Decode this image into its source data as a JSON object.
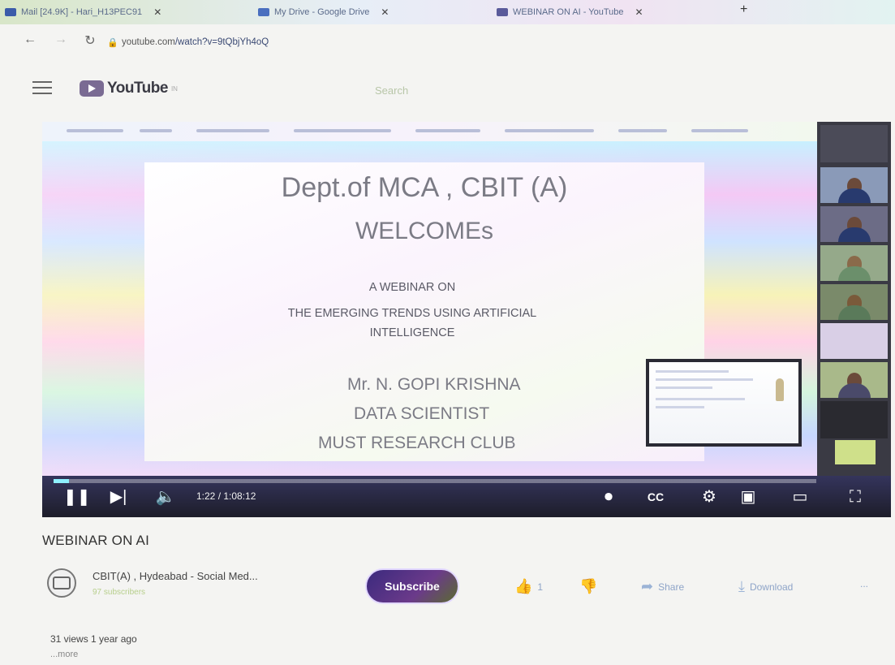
{
  "browser": {
    "tabs": [
      {
        "title": "Mail [24.9K] - Hari_H13PEC91",
        "favicon": "gmail-icon",
        "color": "#3b5ba9"
      },
      {
        "title": "My Drive - Google Drive",
        "favicon": "drive-icon",
        "color": "#4a6fbf"
      },
      {
        "title": "WEBINAR ON AI - YouTube",
        "favicon": "youtube-icon",
        "color": "#5a5a9a"
      }
    ],
    "new_tab_label": "+",
    "url_host": "youtube.com",
    "url_path": "/watch?v=9tQbjYh4oQ"
  },
  "youtube": {
    "logo_text": "YouTube",
    "logo_sup": "IN",
    "search_placeholder": "Search"
  },
  "slide": {
    "line1": "Dept.of MCA , CBIT (A)",
    "line2": "WELCOMEs",
    "subtitle1": "A WEBINAR ON",
    "subtitle2": "THE EMERGING TRENDS USING ARTIFICIAL",
    "subtitle3": "INTELLIGENCE",
    "presenter": "Mr. N. GOPI KRISHNA",
    "role": "DATA SCIENTIST",
    "org": "MUST RESEARCH CLUB"
  },
  "player": {
    "time": "1:22 / 1:08:12",
    "progress_fraction": 0.02
  },
  "video": {
    "title": "WEBINAR ON AI",
    "channel": "CBIT(A) , Hydeabad - Social Med...",
    "subscribers": "97 subscribers",
    "subscribe_label": "Subscribe",
    "likes": "1",
    "share_label": "Share",
    "download_label": "Download",
    "more_label": "...",
    "stats": "31 views 1 year ago",
    "show_more": "...more"
  }
}
